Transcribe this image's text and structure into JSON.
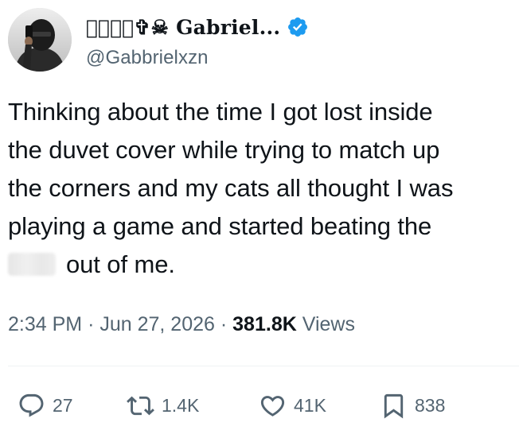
{
  "user": {
    "display_name": "⸾່⸾່✞︎☠ Gabriel...",
    "handle": "@Gabbrielxzn",
    "verified": true,
    "verified_color": "#1d9bf0"
  },
  "tweet": {
    "lines": [
      "Thinking about the time I got lost inside",
      "the duvet cover while trying to match up",
      "the corners and my cats all thought I was",
      "playing a game and started beating the"
    ],
    "last_line_after_redaction": "out of me."
  },
  "meta": {
    "time": "2:34 PM",
    "separator": "·",
    "date": "Jun 27, 2026",
    "views_count": "381.8K",
    "views_label": "Views"
  },
  "actions": {
    "replies": "27",
    "reposts": "1.4K",
    "likes": "41K",
    "bookmarks": "838"
  },
  "icons": {
    "reply": "reply-icon",
    "repost": "repost-icon",
    "like": "heart-icon",
    "bookmark": "bookmark-icon",
    "verified": "verified-badge-icon"
  }
}
